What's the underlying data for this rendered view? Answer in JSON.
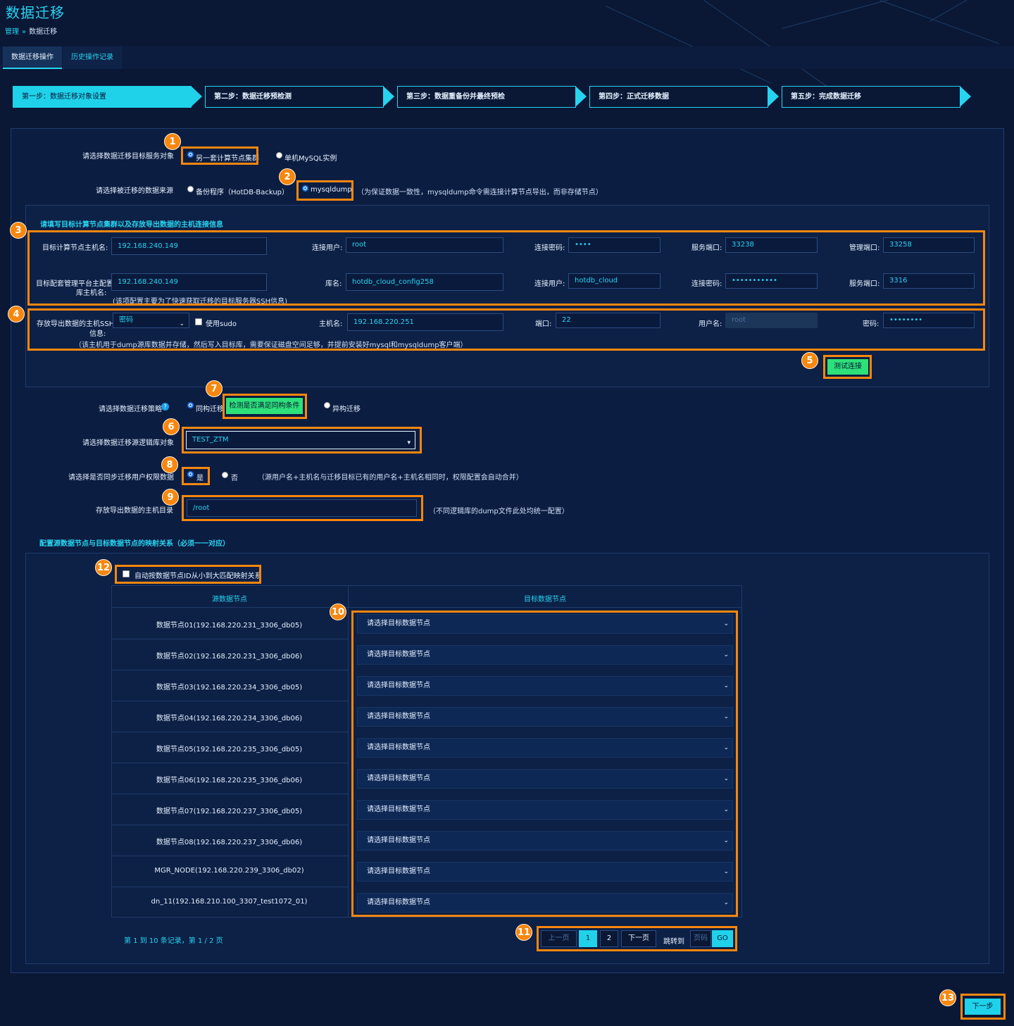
{
  "header": {
    "title": "数据迁移",
    "breadcrumb": [
      "管理",
      "»",
      "数据迁移"
    ]
  },
  "tabs": [
    {
      "label": "数据迁移操作",
      "active": true
    },
    {
      "label": "历史操作记录",
      "active": false
    }
  ],
  "steps": [
    "第一步：数据迁移对象设置",
    "第二步：数据迁移预检测",
    "第三步：数据重备份并最终预检",
    "第四步：正式迁移数据",
    "第五步：完成数据迁移"
  ],
  "target_service": {
    "label": "请选择数据迁移目标服务对象",
    "options": [
      "另一套计算节点集群",
      "单机MySQL实例"
    ],
    "selected": 0
  },
  "data_source": {
    "label": "请选择被迁移的数据来源",
    "options": [
      "备份程序（HotDB-Backup）",
      "mysqldump"
    ],
    "selected": 1,
    "hint": "（为保证数据一致性，mysqldump命令需连接计算节点导出，而非存储节点）"
  },
  "conn_section": {
    "title": "请填写目标计算节点集群以及存放导出数据的主机连接信息",
    "row1": {
      "host_label": "目标计算节点主机名:",
      "host_value": "192.168.240.149",
      "user_label": "连接用户:",
      "user_value": "root",
      "pwd_label": "连接密码:",
      "pwd_value": "••••",
      "service_port_label": "服务端口:",
      "service_port_value": "33238",
      "mgmt_port_label": "管理端口:",
      "mgmt_port_value": "33258"
    },
    "row2": {
      "host_label_line1": "目标配套管理平台主配置",
      "host_label_line2": "库主机名:",
      "host_value": "192.168.240.149",
      "db_label": "库名:",
      "db_value": "hotdb_cloud_config258",
      "user_label": "连接用户:",
      "user_value": "hotdb_cloud",
      "pwd_label": "连接密码:",
      "pwd_value": "•••••••••••",
      "port_label": "服务端口:",
      "port_value": "3316",
      "note": "(该项配置主要为了快速获取迁移的目标服务器SSH信息)"
    },
    "ssh": {
      "label_line1": "存放导出数据的主机SSH",
      "label_line2": "信息:",
      "auth_value": "密码",
      "sudo_label": "使用sudo",
      "hostname_label": "主机名:",
      "hostname_value": "192.168.220.251",
      "port_label": "端口:",
      "port_value": "22",
      "user_label": "用户名:",
      "user_value": "root",
      "pwd_label": "密码:",
      "pwd_value": "••••••••",
      "note": "（该主机用于dump源库数据并存储，然后写入目标库，需要保证磁盘空间足够，并提前安装好mysql和mysqldump客户端）"
    },
    "test_button": "测试连接"
  },
  "strategy": {
    "label": "请选择数据迁移策略",
    "help_icon": "?",
    "options": [
      "同构迁移",
      "异构迁移"
    ],
    "selected": 0,
    "check_button": "检测是否满足同构条件"
  },
  "logical_db": {
    "label": "请选择数据迁移源逻辑库对象",
    "value": "TEST_ZTM"
  },
  "sync_privs": {
    "label": "请选择是否同步迁移用户权限数据",
    "options": [
      "是",
      "否"
    ],
    "selected": 0,
    "hint": "（源用户名+主机名与迁移目标已有的用户名+主机名相同时，权限配置会自动合并）"
  },
  "export_dir": {
    "label": "存放导出数据的主机目录",
    "value": "/root",
    "hint": "（不同逻辑库的dump文件此处均统一配置）"
  },
  "mapping": {
    "title": "配置源数据节点与目标数据节点的映射关系（必须一一对应）",
    "auto_label": "自动按数据节点ID从小到大匹配映射关系",
    "columns": [
      "源数据节点",
      "目标数据节点"
    ],
    "select_placeholder": "请选择目标数据节点",
    "rows": [
      "数据节点01(192.168.220.231_3306_db05)",
      "数据节点02(192.168.220.231_3306_db06)",
      "数据节点03(192.168.220.234_3306_db05)",
      "数据节点04(192.168.220.234_3306_db06)",
      "数据节点05(192.168.220.235_3306_db05)",
      "数据节点06(192.168.220.235_3306_db06)",
      "数据节点07(192.168.220.237_3306_db05)",
      "数据节点08(192.168.220.237_3306_db06)",
      "MGR_NODE(192.168.220.239_3306_db02)",
      "dn_11(192.168.210.100_3307_test1072_01)"
    ],
    "record_info": "第 1 到 10 条记录，第 1 / 2 页",
    "pager": {
      "prev": "上一页",
      "pages": [
        "1",
        "2"
      ],
      "next": "下一页",
      "jump_label": "跳转到",
      "page_placeholder": "页码",
      "go": "GO"
    }
  },
  "next_button": "下一步",
  "badges": [
    "1",
    "2",
    "3",
    "4",
    "5",
    "6",
    "7",
    "8",
    "9",
    "10",
    "11",
    "12",
    "13"
  ],
  "colors": {
    "accent": "#1fd2ea",
    "highlight": "#f7870f",
    "background": "#0a1836",
    "green": "#2de07a"
  }
}
